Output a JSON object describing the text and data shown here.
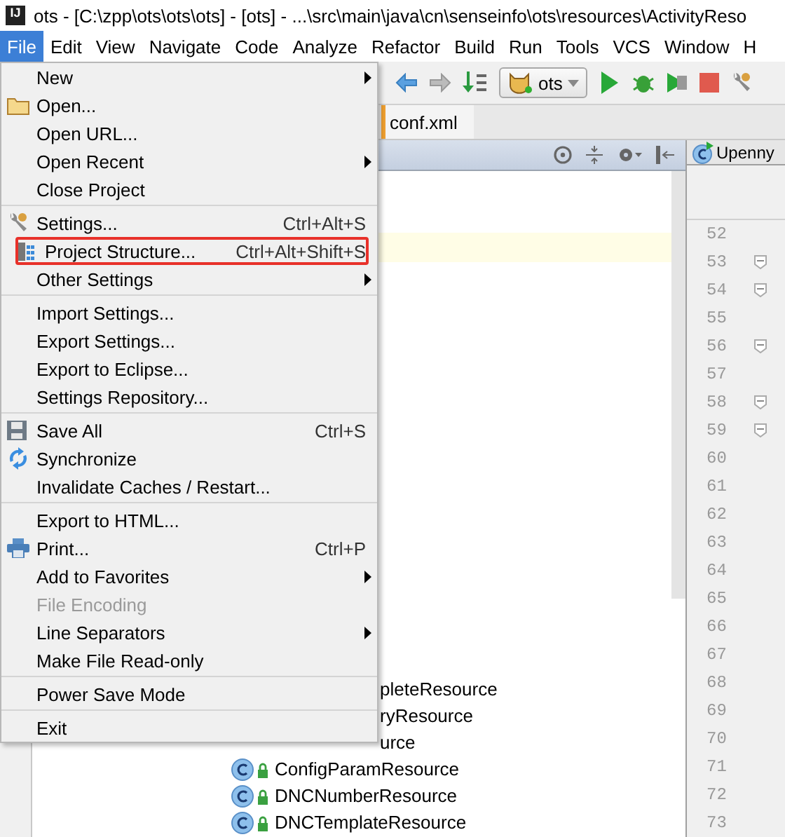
{
  "window": {
    "logo": "IJ",
    "title": "ots - [C:\\zpp\\ots\\ots\\ots] - [ots] - ...\\src\\main\\java\\cn\\senseinfo\\ots\\resources\\ActivityReso"
  },
  "menubar": [
    {
      "label": "File",
      "selected": true
    },
    {
      "label": "Edit",
      "selected": false
    },
    {
      "label": "View",
      "selected": false
    },
    {
      "label": "Navigate",
      "selected": false
    },
    {
      "label": "Code",
      "selected": false
    },
    {
      "label": "Analyze",
      "selected": false
    },
    {
      "label": "Refactor",
      "selected": false
    },
    {
      "label": "Build",
      "selected": false
    },
    {
      "label": "Run",
      "selected": false
    },
    {
      "label": "Tools",
      "selected": false
    },
    {
      "label": "VCS",
      "selected": false
    },
    {
      "label": "Window",
      "selected": false
    },
    {
      "label": "H",
      "selected": false
    }
  ],
  "toolbar": {
    "run_config": "ots"
  },
  "editor_tab": "conf.xml",
  "right_tab": "Upenny",
  "file_menu": [
    [
      {
        "label": "New",
        "submenu": true,
        "disabled": false,
        "outlined": false
      },
      {
        "label": "Open...",
        "submenu": false,
        "disabled": false,
        "outlined": false
      },
      {
        "label": "Open URL...",
        "submenu": false,
        "disabled": false,
        "outlined": false
      },
      {
        "label": "Open Recent",
        "submenu": true,
        "disabled": false,
        "outlined": false
      },
      {
        "label": "Close Project",
        "submenu": false,
        "disabled": false,
        "outlined": false
      }
    ],
    [
      {
        "label": "Settings...",
        "shortcut": "Ctrl+Alt+S",
        "submenu": false,
        "disabled": false,
        "outlined": false
      },
      {
        "label": "Project Structure...",
        "shortcut": "Ctrl+Alt+Shift+S",
        "submenu": false,
        "disabled": false,
        "outlined": true
      },
      {
        "label": "Other Settings",
        "submenu": true,
        "disabled": false,
        "outlined": false
      }
    ],
    [
      {
        "label": "Import Settings...",
        "submenu": false,
        "disabled": false,
        "outlined": false
      },
      {
        "label": "Export Settings...",
        "submenu": false,
        "disabled": false,
        "outlined": false
      },
      {
        "label": "Export to Eclipse...",
        "submenu": false,
        "disabled": false,
        "outlined": false
      },
      {
        "label": "Settings Repository...",
        "submenu": false,
        "disabled": false,
        "outlined": false
      }
    ],
    [
      {
        "label": "Save All",
        "shortcut": "Ctrl+S",
        "submenu": false,
        "disabled": false,
        "outlined": false
      },
      {
        "label": "Synchronize",
        "submenu": false,
        "disabled": false,
        "outlined": false
      },
      {
        "label": "Invalidate Caches / Restart...",
        "submenu": false,
        "disabled": false,
        "outlined": false
      }
    ],
    [
      {
        "label": "Export to HTML...",
        "submenu": false,
        "disabled": false,
        "outlined": false
      },
      {
        "label": "Print...",
        "shortcut": "Ctrl+P",
        "submenu": false,
        "disabled": false,
        "outlined": false
      },
      {
        "label": "Add to Favorites",
        "submenu": true,
        "disabled": false,
        "outlined": false
      },
      {
        "label": "File Encoding",
        "submenu": false,
        "disabled": true,
        "outlined": false
      },
      {
        "label": "Line Separators",
        "submenu": true,
        "disabled": false,
        "outlined": false
      },
      {
        "label": "Make File Read-only",
        "submenu": false,
        "disabled": false,
        "outlined": false
      }
    ],
    [
      {
        "label": "Power Save Mode",
        "submenu": false,
        "disabled": false,
        "outlined": false
      }
    ],
    [
      {
        "label": "Exit",
        "submenu": false,
        "disabled": false,
        "outlined": false
      }
    ]
  ],
  "tree": [
    {
      "text": "pleteResource",
      "kind": "cut"
    },
    {
      "text": "ryResource",
      "kind": "cut"
    },
    {
      "text": "urce",
      "kind": "cut"
    },
    {
      "text": "ConfigParamResource",
      "kind": "class"
    },
    {
      "text": "DNCNumberResource",
      "kind": "class"
    },
    {
      "text": "DNCTemplateResource",
      "kind": "class"
    }
  ],
  "line_numbers": [
    {
      "n": "52",
      "fold": false
    },
    {
      "n": "53",
      "fold": true
    },
    {
      "n": "54",
      "fold": true
    },
    {
      "n": "55",
      "fold": false
    },
    {
      "n": "56",
      "fold": true
    },
    {
      "n": "57",
      "fold": false
    },
    {
      "n": "58",
      "fold": true
    },
    {
      "n": "59",
      "fold": true
    },
    {
      "n": "60",
      "fold": false
    },
    {
      "n": "61",
      "fold": false
    },
    {
      "n": "62",
      "fold": false
    },
    {
      "n": "63",
      "fold": false
    },
    {
      "n": "64",
      "fold": false
    },
    {
      "n": "65",
      "fold": false
    },
    {
      "n": "66",
      "fold": false
    },
    {
      "n": "67",
      "fold": false
    },
    {
      "n": "68",
      "fold": false
    },
    {
      "n": "69",
      "fold": false
    },
    {
      "n": "70",
      "fold": false
    },
    {
      "n": "71",
      "fold": false
    },
    {
      "n": "72",
      "fold": false
    },
    {
      "n": "73",
      "fold": false
    }
  ]
}
